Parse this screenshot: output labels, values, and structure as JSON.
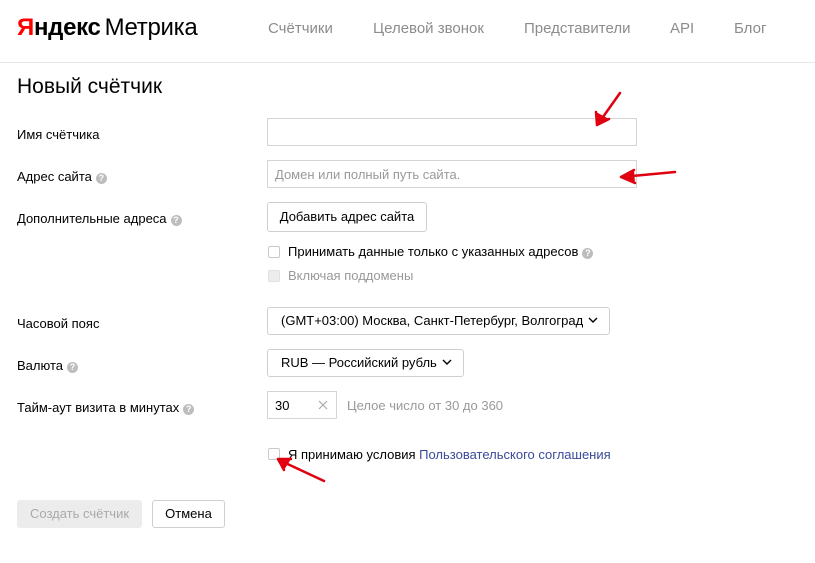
{
  "header": {
    "logo_yandex_first": "Я",
    "logo_yandex_rest": "ндекс",
    "logo_metrika": "Метрика",
    "nav": [
      "Счётчики",
      "Целевой звонок",
      "Представители",
      "API",
      "Блог"
    ]
  },
  "page_title": "Новый счётчик",
  "form": {
    "name_label": "Имя счётчика",
    "name_value": "",
    "site_label": "Адрес сайта",
    "site_placeholder": "Домен или полный путь сайта.",
    "extra_label": "Дополнительные адреса",
    "add_site_button": "Добавить адрес сайта",
    "only_listed_label": "Принимать данные только с указанных адресов",
    "subdomains_label": "Включая поддомены",
    "timezone_label": "Часовой пояс",
    "timezone_value": "(GMT+03:00) Москва, Санкт-Петербург, Волгоград",
    "currency_label": "Валюта",
    "currency_value": "RUB — Российский рубль",
    "timeout_label": "Тайм-аут визита в минутах",
    "timeout_value": "30",
    "timeout_hint": "Целое число от 30 до 360",
    "agree_text": "Я принимаю условия ",
    "agree_link": "Пользовательского соглашения",
    "help_glyph": "?"
  },
  "actions": {
    "create_button": "Создать счётчик",
    "cancel_button": "Отмена"
  },
  "colors": {
    "brand_red": "#ff0000",
    "link": "#3b4a9b",
    "annotation_arrow": "#e0000f"
  }
}
